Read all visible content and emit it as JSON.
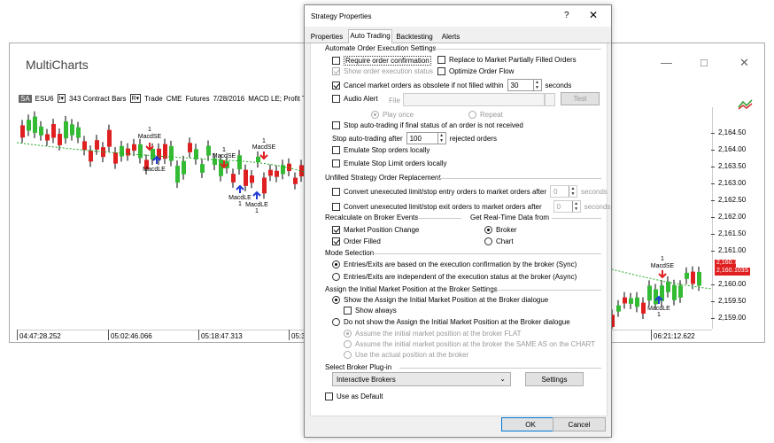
{
  "main": {
    "title": "MultiCharts",
    "info": {
      "symbol_tag": "SA",
      "symbol": "ESU6",
      "bars": "343 Contract Bars",
      "type": "Trade",
      "exchange": "CME",
      "category": "Futures",
      "date": "7/28/2016",
      "strategy": "MACD LE; Profit T"
    },
    "y_labels": [
      "2,164.50",
      "2,164.25",
      "2,164.00",
      "2,163.75",
      "2,163.50",
      "2,163.25",
      "2,163.00",
      "2,162.75",
      "2,162.50",
      "2,162.25",
      "2,162.00",
      "2,161.75",
      "2,161.50",
      "2,161.25",
      "2,161.00",
      "2,160.75",
      "2,160.50",
      "2,160.25",
      "2,160.00",
      "2,159.75",
      "2,159.50",
      "2,159.25",
      "2,159.00"
    ],
    "price_tag": "2,160.75",
    "price_tag2": "103S",
    "x_labels": [
      "04:47:28.252",
      "05:02:46.066",
      "05:18:47.313",
      "05:35:1",
      "06:21:12.622"
    ],
    "signals": {
      "macdse": "MacdSE",
      "macdle": "MacdLE",
      "one": "1"
    }
  },
  "dialog": {
    "title": "Strategy Properties",
    "help": "?",
    "tabs": [
      "Properties",
      "Auto Trading",
      "Backtesting",
      "Alerts"
    ],
    "sec_automate": "Automate Order Execution Settings",
    "require_confirmation": "Require order confirmation",
    "replace_partial": "Replace to Market Partially Filled Orders",
    "show_status": "Show order execution status",
    "optimize_flow": "Optimize Order Flow",
    "cancel_obsolete": "Cancel market orders as obsolete if not filled within",
    "cancel_seconds": "30",
    "seconds": "seconds",
    "audio_alert": "Audio Alert",
    "file_label": "File",
    "test_button": "Test",
    "play_once": "Play once",
    "repeat": "Repeat",
    "stop_not_received": "Stop auto-trading if final status of an order is not received",
    "stop_after": "Stop auto-trading after",
    "stop_after_value": "100",
    "rejected_orders": "rejected orders",
    "emulate_stop": "Emulate Stop orders locally",
    "emulate_stop_limit": "Emulate Stop Limit orders locally",
    "sec_unfilled": "Unfilled Strategy Order Replacement",
    "convert_entry": "Convert unexecuted limit/stop entry orders to market orders after",
    "convert_exit": "Convert unexecuted limit/stop exit orders to market orders after",
    "zero": "0",
    "sec_recalc": "Recalculate on Broker Events",
    "sec_realtime": "Get Real-Time Data from",
    "market_position_change": "Market Position Change",
    "order_filled": "Order Filled",
    "broker": "Broker",
    "chart": "Chart",
    "sec_mode": "Mode Selection",
    "mode_sync": "Entries/Exits are based on the execution confirmation by the broker (Sync)",
    "mode_async": "Entries/Exits are independent of the execution status at the broker (Async)",
    "sec_assign": "Assign the Initial Market Position at the Broker Settings",
    "show_assign": "Show the Assign the Initial Market Position at the Broker dialogue",
    "show_always": "Show always",
    "do_not_show": "Do not show the Assign the Initial Market Position at the Broker dialogue",
    "assume_flat": "Assume the initial market position at the broker FLAT",
    "assume_same": "Assume the initial market position at the broker the SAME AS on the CHART",
    "use_actual": "Use the actual position at the broker",
    "sec_plugin": "Select Broker Plug-in",
    "plugin_value": "Interactive Brokers",
    "settings_button": "Settings",
    "use_default": "Use as Default",
    "ok": "OK",
    "cancel": "Cancel"
  }
}
